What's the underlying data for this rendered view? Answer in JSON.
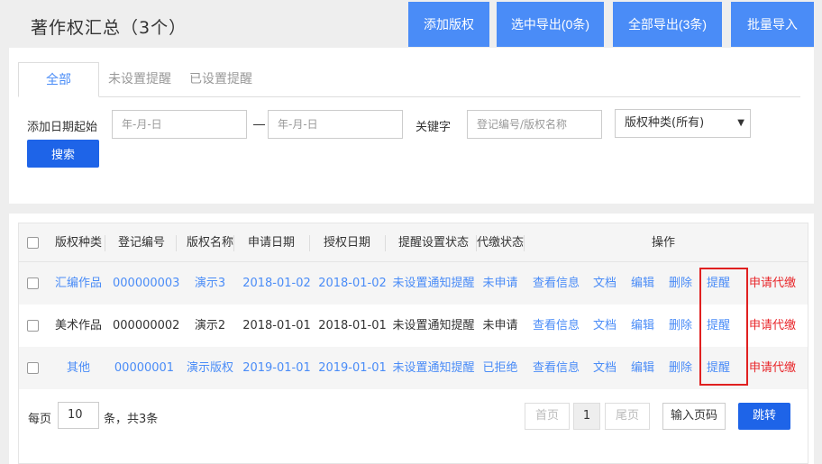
{
  "header": {
    "title": "著作权汇总（3个）",
    "buttons": {
      "add": "添加版权",
      "export_selected": "选中导出(0条)",
      "export_all": "全部导出(3条)",
      "batch_import": "批量导入"
    }
  },
  "tabs": [
    {
      "label": "全部",
      "active": true
    },
    {
      "label": "未设置提醒",
      "active": false
    },
    {
      "label": "已设置提醒",
      "active": false
    }
  ],
  "filters": {
    "date_label": "添加日期起始",
    "date_start_placeholder": "年-月-日",
    "date_end_placeholder": "年-月-日",
    "keyword_label": "关键字",
    "keyword_placeholder": "登记编号/版权名称",
    "type_select": "版权种类(所有)",
    "search_button": "搜索"
  },
  "table": {
    "headers": [
      "版权种类",
      "登记编号",
      "版权名称",
      "申请日期",
      "授权日期",
      "提醒设置状态",
      "代缴状态",
      "操作"
    ],
    "rows": [
      {
        "type": "汇编作品",
        "reg_no": "000000003",
        "name": "演示3",
        "apply_date": "2018-01-02",
        "grant_date": "2018-01-02",
        "remind_status": "未设置通知提醒",
        "pay_status": "未申请",
        "view": "查看信息",
        "doc": "文档",
        "edit": "编辑",
        "delete": "删除",
        "remind": "提醒",
        "apply_pay": "申请代缴"
      },
      {
        "type": "美术作品",
        "reg_no": "000000002",
        "name": "演示2",
        "apply_date": "2018-01-01",
        "grant_date": "2018-01-01",
        "remind_status": "未设置通知提醒",
        "pay_status": "未申请",
        "view": "查看信息",
        "doc": "文档",
        "edit": "编辑",
        "delete": "删除",
        "remind": "提醒",
        "apply_pay": "申请代缴"
      },
      {
        "type": "其他",
        "reg_no": "00000001",
        "name": "演示版权",
        "apply_date": "2019-01-01",
        "grant_date": "2019-01-01",
        "remind_status": "未设置通知提醒",
        "pay_status": "已拒绝",
        "view": "查看信息",
        "doc": "文档",
        "edit": "编辑",
        "delete": "删除",
        "remind": "提醒",
        "apply_pay": "申请代缴"
      }
    ]
  },
  "pager": {
    "per_page_label": "每页",
    "per_page_value": "10",
    "summary": "条，共3条",
    "first": "首页",
    "current": "1",
    "last": "尾页",
    "goto_placeholder": "输入页码",
    "jump": "跳转"
  },
  "colors": {
    "primary": "#4a8cf7",
    "button_dark": "#1e64e8",
    "danger": "#e8262a",
    "highlight": "#e02020"
  }
}
